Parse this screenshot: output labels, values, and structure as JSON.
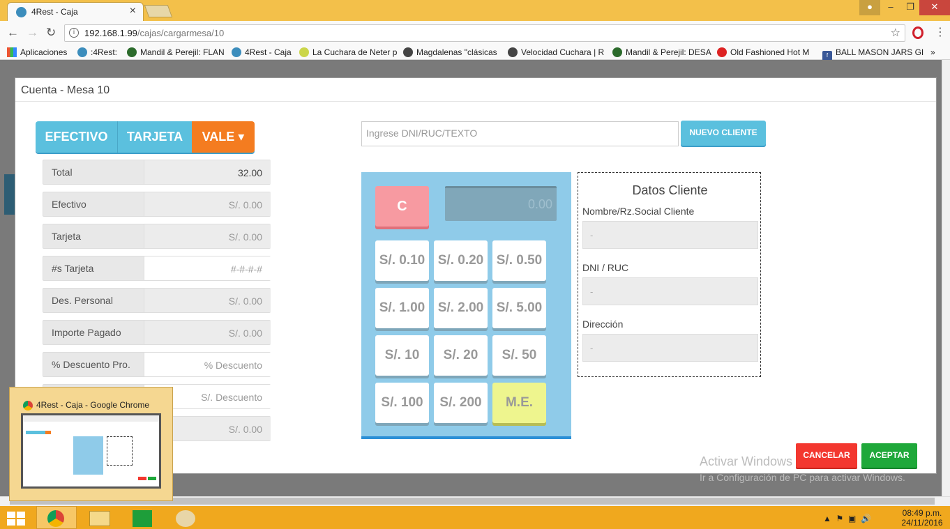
{
  "browser": {
    "tab_title": "4Rest - Caja",
    "tab_icon": "4Rest",
    "url_host": "192.168.1.99",
    "url_path": "/cajas/cargarmesa/10",
    "bookmarks": [
      {
        "label": "Aplicaciones"
      },
      {
        "label": ":4Rest:"
      },
      {
        "label": "Mandil & Perejil: FLAN"
      },
      {
        "label": "4Rest - Caja"
      },
      {
        "label": "La Cuchara de Neter p"
      },
      {
        "label": "Magdalenas \"clásicas"
      },
      {
        "label": "Velocidad Cuchara | R"
      },
      {
        "label": "Mandil & Perejil: DESA"
      },
      {
        "label": "Old Fashioned Hot M"
      },
      {
        "label": "BALL MASON JARS GI"
      }
    ],
    "more_bookmarks": "»"
  },
  "modal": {
    "title": "Cuenta - Mesa 10"
  },
  "payment_tabs": {
    "efectivo": "EFECTIVO",
    "tarjeta": "TARJETA",
    "vale": "VALE ▾"
  },
  "fields": [
    {
      "label": "Total",
      "value": "32.00"
    },
    {
      "label": "Efectivo",
      "value": "S/. 0.00"
    },
    {
      "label": "Tarjeta",
      "value": "S/. 0.00"
    },
    {
      "label": "#s Tarjeta",
      "value": "#-#-#-#"
    },
    {
      "label": "Des. Personal",
      "value": "S/. 0.00"
    },
    {
      "label": "Importe Pagado",
      "value": "S/. 0.00"
    },
    {
      "label": "% Descuento Pro.",
      "value": "% Descuento"
    },
    {
      "label": "",
      "value": "S/. Descuento"
    },
    {
      "label": "",
      "value": "S/. 0.00"
    }
  ],
  "search": {
    "placeholder": "Ingrese DNI/RUC/TEXTO",
    "new_client": "NUEVO CLIENTE"
  },
  "calculator": {
    "clear": "C",
    "display": "0.00",
    "buttons": [
      "S/. 0.10",
      "S/. 0.20",
      "S/. 0.50",
      "S/. 1.00",
      "S/. 2.00",
      "S/. 5.00",
      "S/. 10",
      "S/. 20",
      "S/. 50",
      "S/. 100",
      "S/. 200",
      "M.E."
    ]
  },
  "client": {
    "title": "Datos Cliente",
    "name_label": "Nombre/Rz.Social Cliente",
    "name_value": "-",
    "dni_label": "DNI / RUC",
    "dni_value": "-",
    "address_label": "Dirección",
    "address_value": "-"
  },
  "actions": {
    "cancel": "CANCELAR",
    "accept": "ACEPTAR"
  },
  "watermark": {
    "line1": "Activar Windows",
    "line2": "Ir a Configuración de PC para activar Windows."
  },
  "thumbnail": {
    "title": "4Rest - Caja - Google Chrome"
  },
  "taskbar": {
    "time": "08:49 p.m.",
    "date": "24/11/2016"
  }
}
